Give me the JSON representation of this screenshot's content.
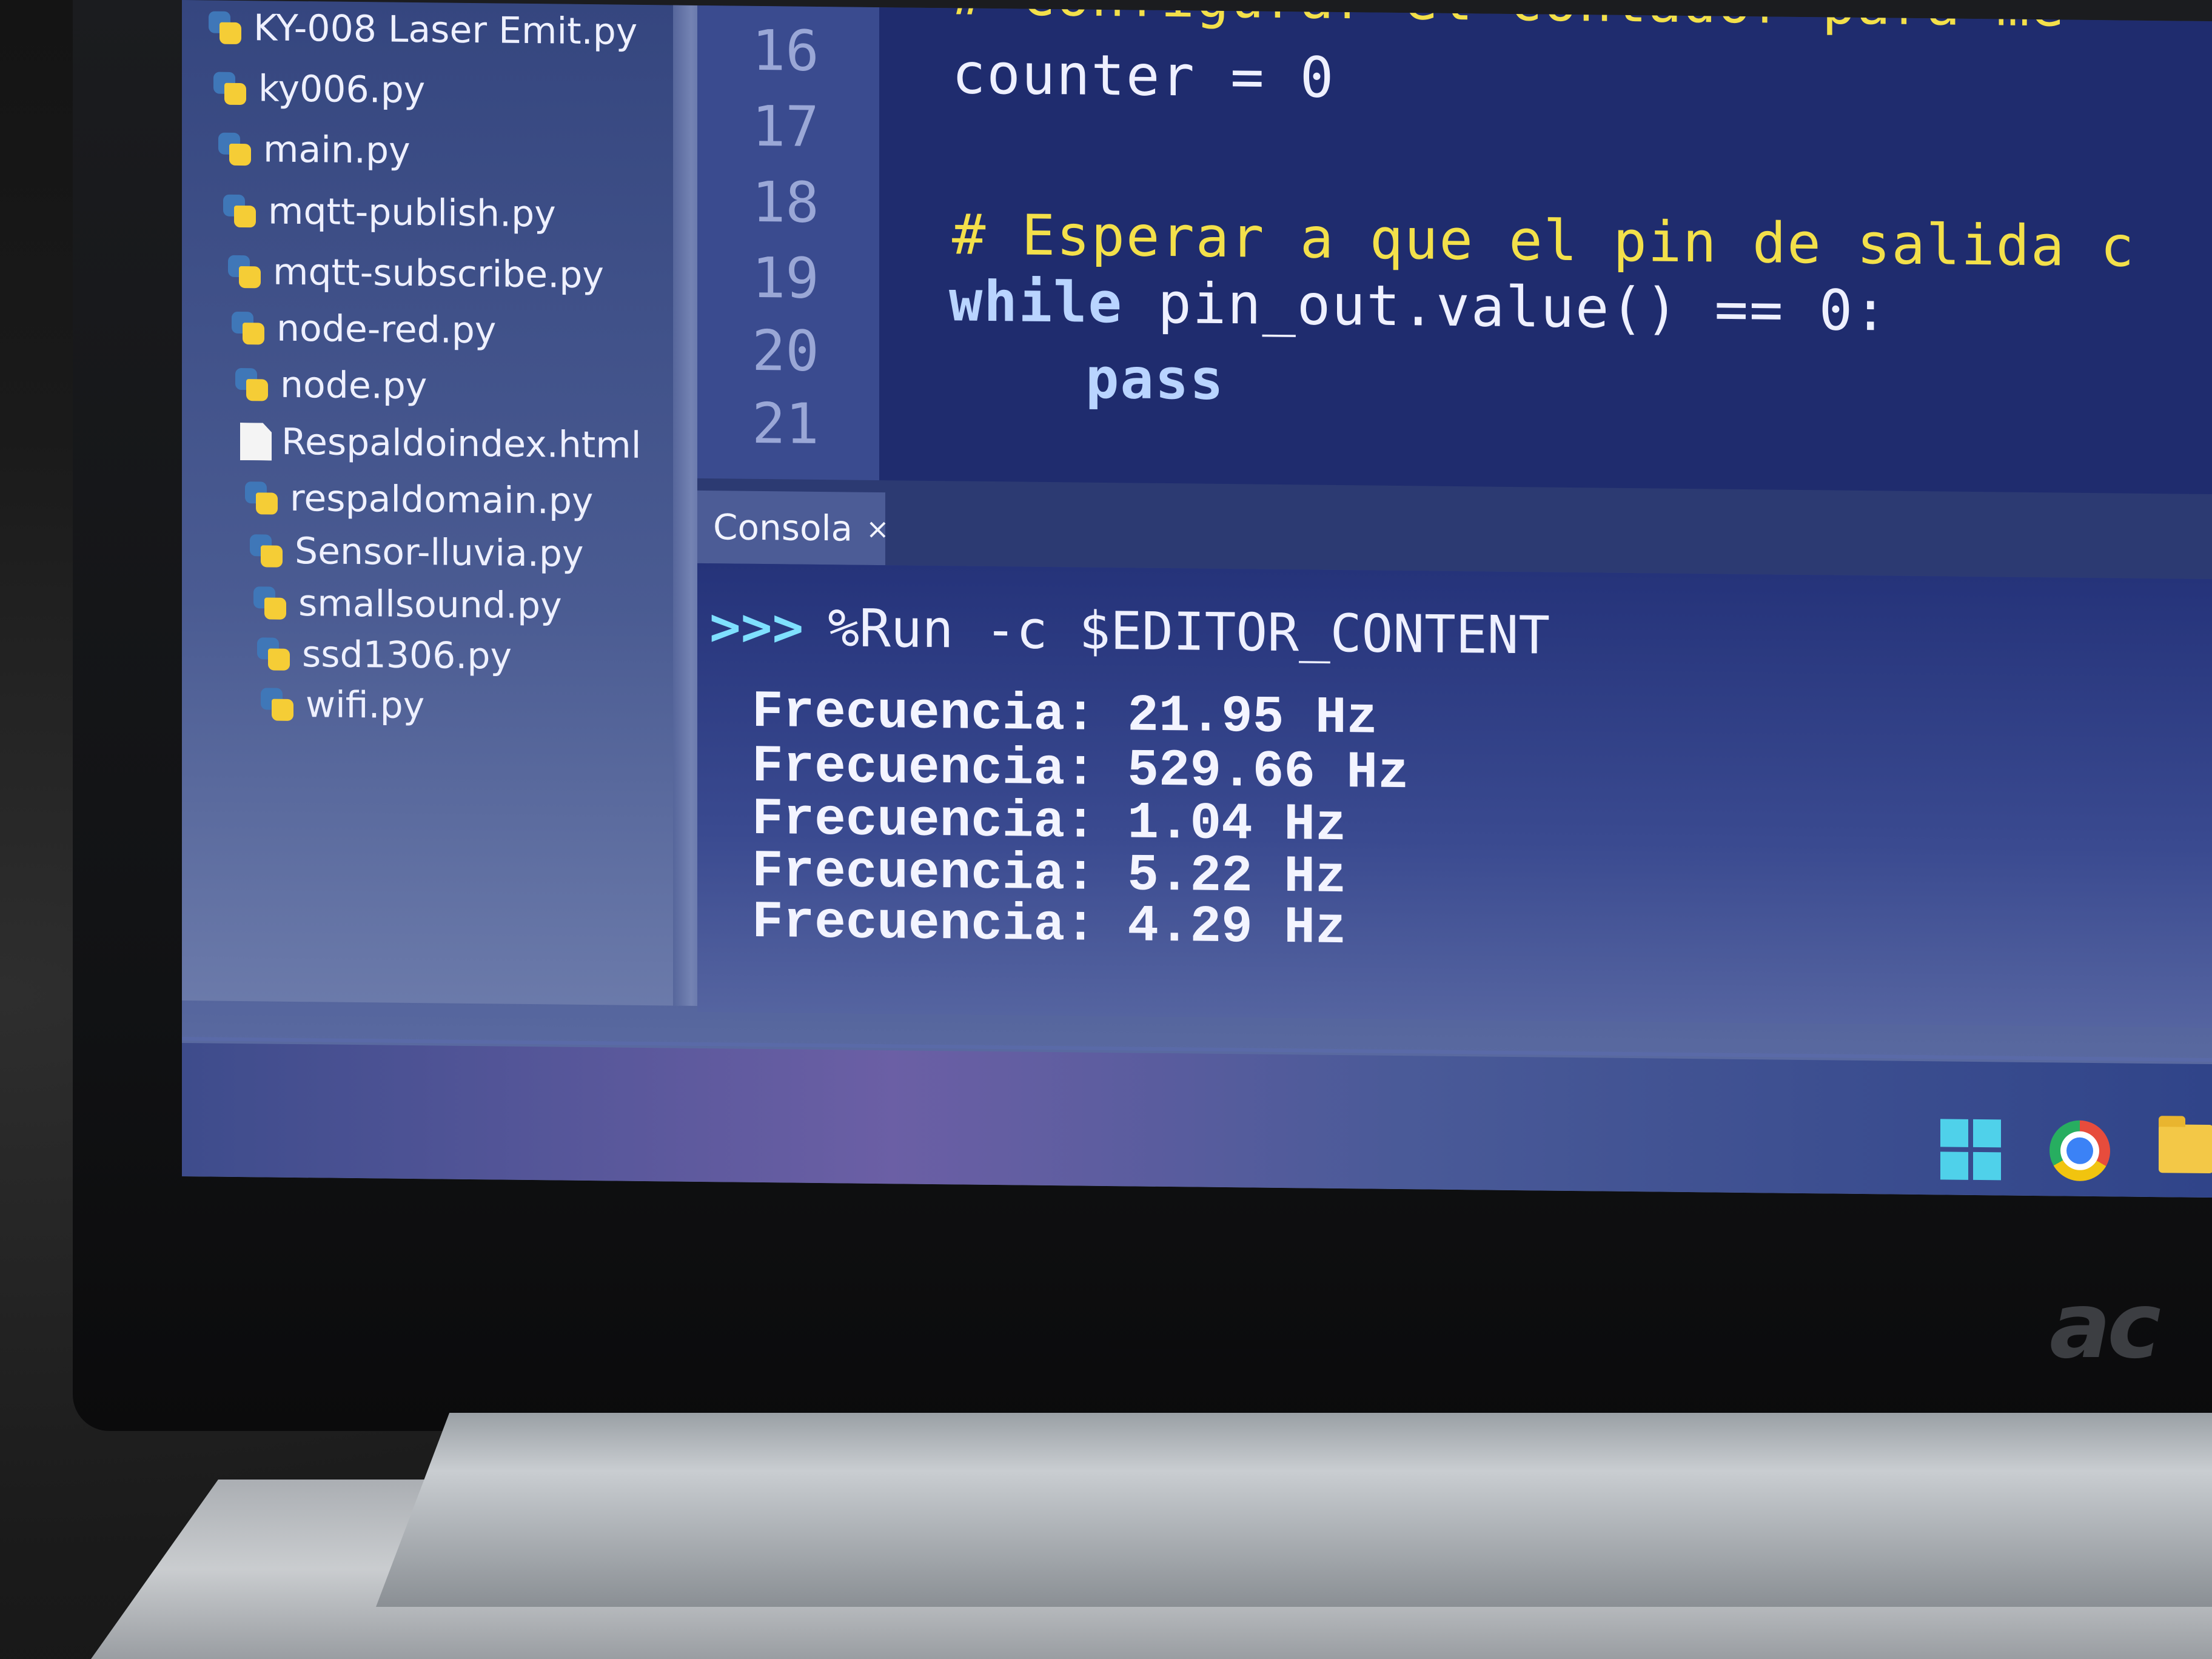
{
  "files": [
    {
      "name": "KY-008 Laser Emit.py",
      "icon": "python-file-icon"
    },
    {
      "name": "ky006.py",
      "icon": "python-file-icon"
    },
    {
      "name": "main.py",
      "icon": "python-file-icon"
    },
    {
      "name": "mqtt-publish.py",
      "icon": "python-file-icon"
    },
    {
      "name": "mqtt-subscribe.py",
      "icon": "python-file-icon"
    },
    {
      "name": "node-red.py",
      "icon": "python-file-icon"
    },
    {
      "name": "node.py",
      "icon": "python-file-icon"
    },
    {
      "name": "Respaldoindex.html",
      "icon": "document-file-icon"
    },
    {
      "name": "respaldomain.py",
      "icon": "python-file-icon"
    },
    {
      "name": "Sensor-lluvia.py",
      "icon": "python-file-icon"
    },
    {
      "name": "smallsound.py",
      "icon": "python-file-icon"
    },
    {
      "name": "ssd1306.py",
      "icon": "python-file-icon"
    },
    {
      "name": "wifi.py",
      "icon": "python-file-icon"
    }
  ],
  "editor": {
    "line_numbers": [
      "16",
      "17",
      "18",
      "19",
      "20",
      "21"
    ],
    "lines": {
      "l15": "# Configurar el contador para me",
      "l16_var": "counter = 0",
      "l18_comment": "# Esperar a que el pin de salida c",
      "l19_kw": "while",
      "l19_rest": " pin_out.value() == 0:",
      "l20_kw": "pass"
    }
  },
  "console": {
    "tab_label": "Consola",
    "tab_close": "×",
    "prompt": ">>>",
    "command": "%Run -c $EDITOR_CONTENT",
    "output": [
      "Frecuencia: 21.95 Hz",
      "Frecuencia: 529.66 Hz",
      "Frecuencia: 1.04 Hz",
      "Frecuencia: 5.22 Hz",
      "Frecuencia: 4.29 Hz"
    ]
  },
  "laptop": {
    "brand": "ac"
  },
  "taskbar": {
    "icons": [
      "windows-start-icon",
      "chrome-icon",
      "file-explorer-icon"
    ]
  }
}
